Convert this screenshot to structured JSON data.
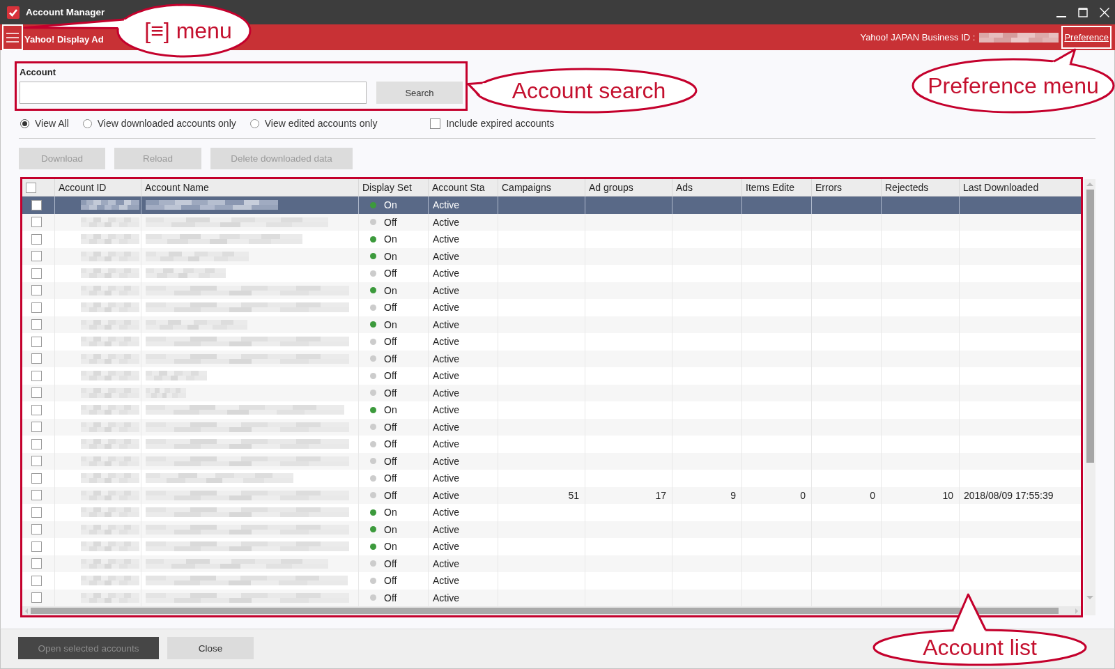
{
  "window": {
    "title": "Account Manager"
  },
  "header": {
    "product": "Yahoo! Display Ad",
    "business_id_label": "Yahoo! JAPAN Business ID :",
    "preference": "Preference"
  },
  "search": {
    "label": "Account",
    "button": "Search"
  },
  "view_filter": [
    {
      "label": "View All",
      "selected": true
    },
    {
      "label": "View downloaded accounts only",
      "selected": false
    },
    {
      "label": "View edited accounts only",
      "selected": false
    }
  ],
  "include_expired": {
    "label": "Include expired accounts",
    "checked": false
  },
  "toolbar": [
    {
      "label": "Download",
      "disabled": true
    },
    {
      "label": "Reload",
      "disabled": true
    },
    {
      "label": "Delete downloaded data",
      "disabled": true
    }
  ],
  "table": {
    "header_checked": false,
    "columns": [
      "Account ID",
      "Account Name",
      "Display Set",
      "Account Sta",
      "Campaigns",
      "Ad groups",
      "Ads",
      "Items Edite",
      "Errors",
      "Rejecteds",
      "Last Downloaded"
    ],
    "rows": [
      {
        "checked": false,
        "selected": true,
        "cells": [
          {
            "kind": "redacted"
          },
          {
            "kind": "redacted"
          },
          {
            "kind": "status",
            "text": "On",
            "color": "#3c9a3c"
          },
          {
            "kind": "text",
            "text": "Active"
          }
        ]
      },
      {
        "checked": false,
        "selected": false,
        "cells": [
          {
            "kind": "redacted"
          },
          {
            "kind": "redacted"
          },
          {
            "kind": "status",
            "text": "Off",
            "color": "#cccccc"
          },
          {
            "kind": "text",
            "text": "Active"
          }
        ]
      },
      {
        "checked": false,
        "selected": false,
        "cells": [
          {
            "kind": "redacted"
          },
          {
            "kind": "redacted"
          },
          {
            "kind": "status",
            "text": "On",
            "color": "#3c9a3c"
          },
          {
            "kind": "text",
            "text": "Active"
          }
        ]
      },
      {
        "checked": false,
        "selected": false,
        "cells": [
          {
            "kind": "redacted"
          },
          {
            "kind": "redacted"
          },
          {
            "kind": "status",
            "text": "On",
            "color": "#3c9a3c"
          },
          {
            "kind": "text",
            "text": "Active"
          }
        ]
      },
      {
        "checked": false,
        "selected": false,
        "cells": [
          {
            "kind": "redacted"
          },
          {
            "kind": "redacted"
          },
          {
            "kind": "status",
            "text": "Off",
            "color": "#cccccc"
          },
          {
            "kind": "text",
            "text": "Active"
          }
        ]
      },
      {
        "checked": false,
        "selected": false,
        "cells": [
          {
            "kind": "redacted"
          },
          {
            "kind": "redacted"
          },
          {
            "kind": "status",
            "text": "On",
            "color": "#3c9a3c"
          },
          {
            "kind": "text",
            "text": "Active"
          }
        ]
      },
      {
        "checked": false,
        "selected": false,
        "cells": [
          {
            "kind": "redacted"
          },
          {
            "kind": "redacted"
          },
          {
            "kind": "status",
            "text": "Off",
            "color": "#cccccc"
          },
          {
            "kind": "text",
            "text": "Active"
          }
        ]
      },
      {
        "checked": false,
        "selected": false,
        "cells": [
          {
            "kind": "redacted"
          },
          {
            "kind": "redacted"
          },
          {
            "kind": "status",
            "text": "On",
            "color": "#3c9a3c"
          },
          {
            "kind": "text",
            "text": "Active"
          }
        ]
      },
      {
        "checked": false,
        "selected": false,
        "cells": [
          {
            "kind": "redacted"
          },
          {
            "kind": "redacted"
          },
          {
            "kind": "status",
            "text": "Off",
            "color": "#cccccc"
          },
          {
            "kind": "text",
            "text": "Active"
          }
        ]
      },
      {
        "checked": false,
        "selected": false,
        "cells": [
          {
            "kind": "redacted"
          },
          {
            "kind": "redacted"
          },
          {
            "kind": "status",
            "text": "Off",
            "color": "#cccccc"
          },
          {
            "kind": "text",
            "text": "Active"
          }
        ]
      },
      {
        "checked": false,
        "selected": false,
        "cells": [
          {
            "kind": "redacted"
          },
          {
            "kind": "redacted"
          },
          {
            "kind": "status",
            "text": "Off",
            "color": "#cccccc"
          },
          {
            "kind": "text",
            "text": "Active"
          }
        ]
      },
      {
        "checked": false,
        "selected": false,
        "cells": [
          {
            "kind": "redacted"
          },
          {
            "kind": "redacted"
          },
          {
            "kind": "status",
            "text": "Off",
            "color": "#cccccc"
          },
          {
            "kind": "text",
            "text": "Active"
          }
        ]
      },
      {
        "checked": false,
        "selected": false,
        "cells": [
          {
            "kind": "redacted"
          },
          {
            "kind": "redacted"
          },
          {
            "kind": "status",
            "text": "On",
            "color": "#3c9a3c"
          },
          {
            "kind": "text",
            "text": "Active"
          }
        ]
      },
      {
        "checked": false,
        "selected": false,
        "cells": [
          {
            "kind": "redacted"
          },
          {
            "kind": "redacted"
          },
          {
            "kind": "status",
            "text": "Off",
            "color": "#cccccc"
          },
          {
            "kind": "text",
            "text": "Active"
          }
        ]
      },
      {
        "checked": false,
        "selected": false,
        "cells": [
          {
            "kind": "redacted"
          },
          {
            "kind": "redacted"
          },
          {
            "kind": "status",
            "text": "Off",
            "color": "#cccccc"
          },
          {
            "kind": "text",
            "text": "Active"
          }
        ]
      },
      {
        "checked": false,
        "selected": false,
        "cells": [
          {
            "kind": "redacted"
          },
          {
            "kind": "redacted"
          },
          {
            "kind": "status",
            "text": "Off",
            "color": "#cccccc"
          },
          {
            "kind": "text",
            "text": "Active"
          }
        ]
      },
      {
        "checked": false,
        "selected": false,
        "cells": [
          {
            "kind": "redacted"
          },
          {
            "kind": "redacted"
          },
          {
            "kind": "status",
            "text": "Off",
            "color": "#cccccc"
          },
          {
            "kind": "text",
            "text": "Active"
          }
        ]
      },
      {
        "checked": false,
        "selected": false,
        "cells": [
          {
            "kind": "redacted"
          },
          {
            "kind": "redacted"
          },
          {
            "kind": "status",
            "text": "Off",
            "color": "#cccccc"
          },
          {
            "kind": "text",
            "text": "Active"
          },
          {
            "kind": "number",
            "text": "51"
          },
          {
            "kind": "number",
            "text": "17"
          },
          {
            "kind": "number",
            "text": "9"
          },
          {
            "kind": "number",
            "text": "0"
          },
          {
            "kind": "number",
            "text": "0"
          },
          {
            "kind": "number",
            "text": "10"
          },
          {
            "kind": "text",
            "text": "2018/08/09 17:55:39"
          }
        ]
      },
      {
        "checked": false,
        "selected": false,
        "cells": [
          {
            "kind": "redacted"
          },
          {
            "kind": "redacted"
          },
          {
            "kind": "status",
            "text": "On",
            "color": "#3c9a3c"
          },
          {
            "kind": "text",
            "text": "Active"
          }
        ]
      },
      {
        "checked": false,
        "selected": false,
        "cells": [
          {
            "kind": "redacted"
          },
          {
            "kind": "redacted"
          },
          {
            "kind": "status",
            "text": "On",
            "color": "#3c9a3c"
          },
          {
            "kind": "text",
            "text": "Active"
          }
        ]
      },
      {
        "checked": false,
        "selected": false,
        "cells": [
          {
            "kind": "redacted"
          },
          {
            "kind": "redacted"
          },
          {
            "kind": "status",
            "text": "On",
            "color": "#3c9a3c"
          },
          {
            "kind": "text",
            "text": "Active"
          }
        ]
      },
      {
        "checked": false,
        "selected": false,
        "cells": [
          {
            "kind": "redacted"
          },
          {
            "kind": "redacted"
          },
          {
            "kind": "status",
            "text": "Off",
            "color": "#cccccc"
          },
          {
            "kind": "text",
            "text": "Active"
          }
        ]
      },
      {
        "checked": false,
        "selected": false,
        "cells": [
          {
            "kind": "redacted"
          },
          {
            "kind": "redacted"
          },
          {
            "kind": "status",
            "text": "Off",
            "color": "#cccccc"
          },
          {
            "kind": "text",
            "text": "Active"
          }
        ]
      },
      {
        "checked": false,
        "selected": false,
        "cells": [
          {
            "kind": "redacted"
          },
          {
            "kind": "redacted"
          },
          {
            "kind": "status",
            "text": "Off",
            "color": "#cccccc"
          },
          {
            "kind": "text",
            "text": "Active"
          }
        ]
      }
    ]
  },
  "footer": {
    "buttons": [
      {
        "label": "Open selected accounts",
        "kind": "primary",
        "disabled": true
      },
      {
        "label": "Close",
        "kind": "secondary",
        "disabled": false
      }
    ]
  },
  "callouts": [
    {
      "text": "[≡] menu"
    },
    {
      "text": "Account search"
    },
    {
      "text": "Preference menu"
    },
    {
      "text": "Account list"
    }
  ]
}
